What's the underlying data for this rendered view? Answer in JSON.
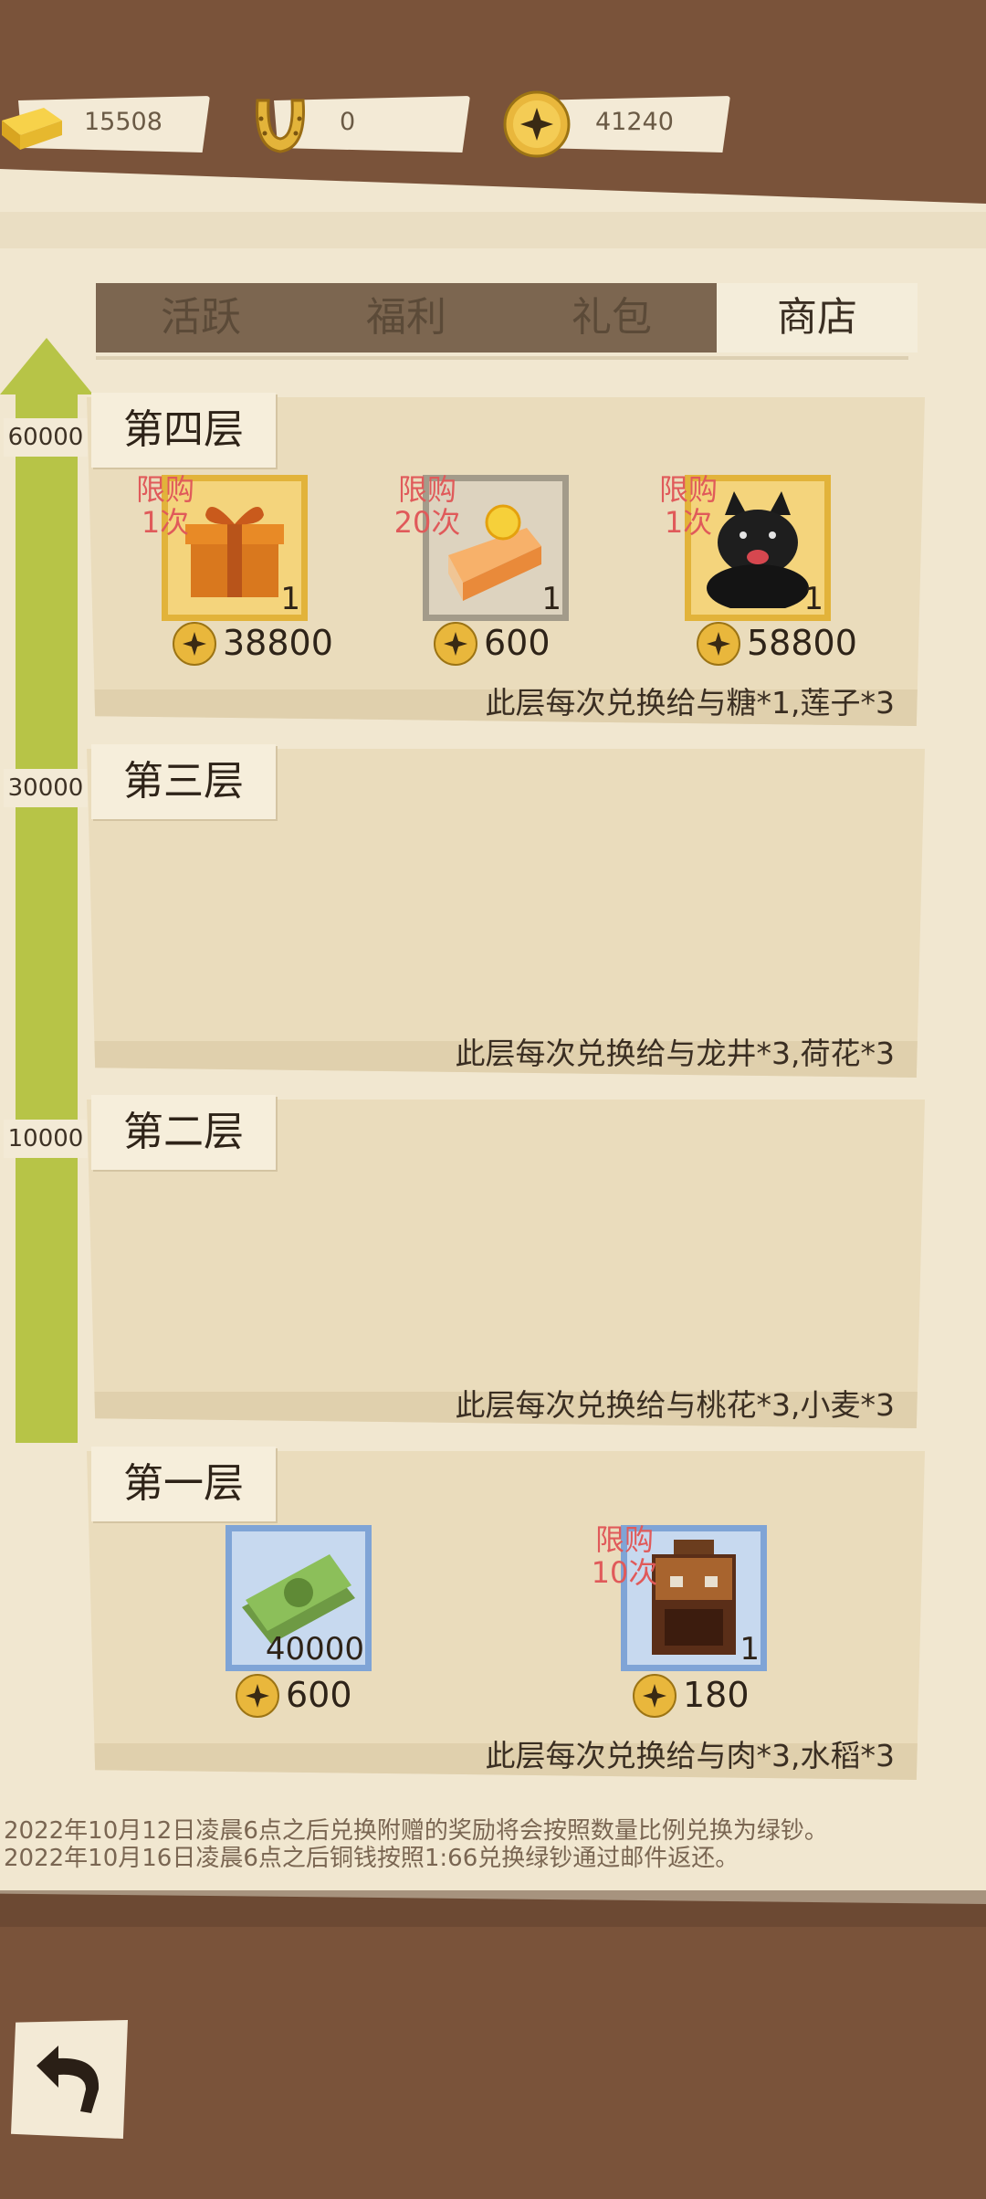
{
  "resources": {
    "gold": "15508",
    "horseshoe": "0",
    "coins": "41240"
  },
  "tabs": [
    {
      "label": "活跃"
    },
    {
      "label": "福利"
    },
    {
      "label": "礼包"
    },
    {
      "label": "商店"
    }
  ],
  "active_tab": "商店",
  "thresholds": [
    "60000",
    "30000",
    "10000"
  ],
  "floors": {
    "f4": {
      "title": "第四层",
      "note": "此层每次兑换给与糖*1,莲子*3",
      "items": [
        {
          "icon": "gift-box-icon",
          "limit": "限购\n1次",
          "count": "1",
          "price": "38800"
        },
        {
          "icon": "cake-icon",
          "limit": "限购\n20次",
          "count": "1",
          "price": "600"
        },
        {
          "icon": "black-dog-icon",
          "limit": "限购\n1次",
          "count": "1",
          "price": "58800"
        }
      ]
    },
    "f3": {
      "title": "第三层",
      "note": "此层每次兑换给与龙井*3,荷花*3"
    },
    "f2": {
      "title": "第二层",
      "note": "此层每次兑换给与桃花*3,小麦*3"
    },
    "f1": {
      "title": "第一层",
      "note": "此层每次兑换给与肉*3,水稻*3",
      "items": [
        {
          "icon": "green-money-icon",
          "amount": "40000",
          "price": "600"
        },
        {
          "icon": "backpack-icon",
          "limit": "限购\n10次",
          "count": "1",
          "price": "180"
        }
      ]
    }
  },
  "footer": {
    "line1": "2022年10月12日凌晨6点之后兑换附赠的奖励将会按照数量比例兑换为绿钞。",
    "line2": "2022年10月16日凌晨6点之后铜钱按照1:66兑换绿钞通过邮件返还。"
  },
  "colors": {
    "background": "#7a533a",
    "panel": "#f1e7d0",
    "progress_green": "#b7c447",
    "limit_red": "#e05a5a",
    "gold_frame": "#e2b33a"
  }
}
